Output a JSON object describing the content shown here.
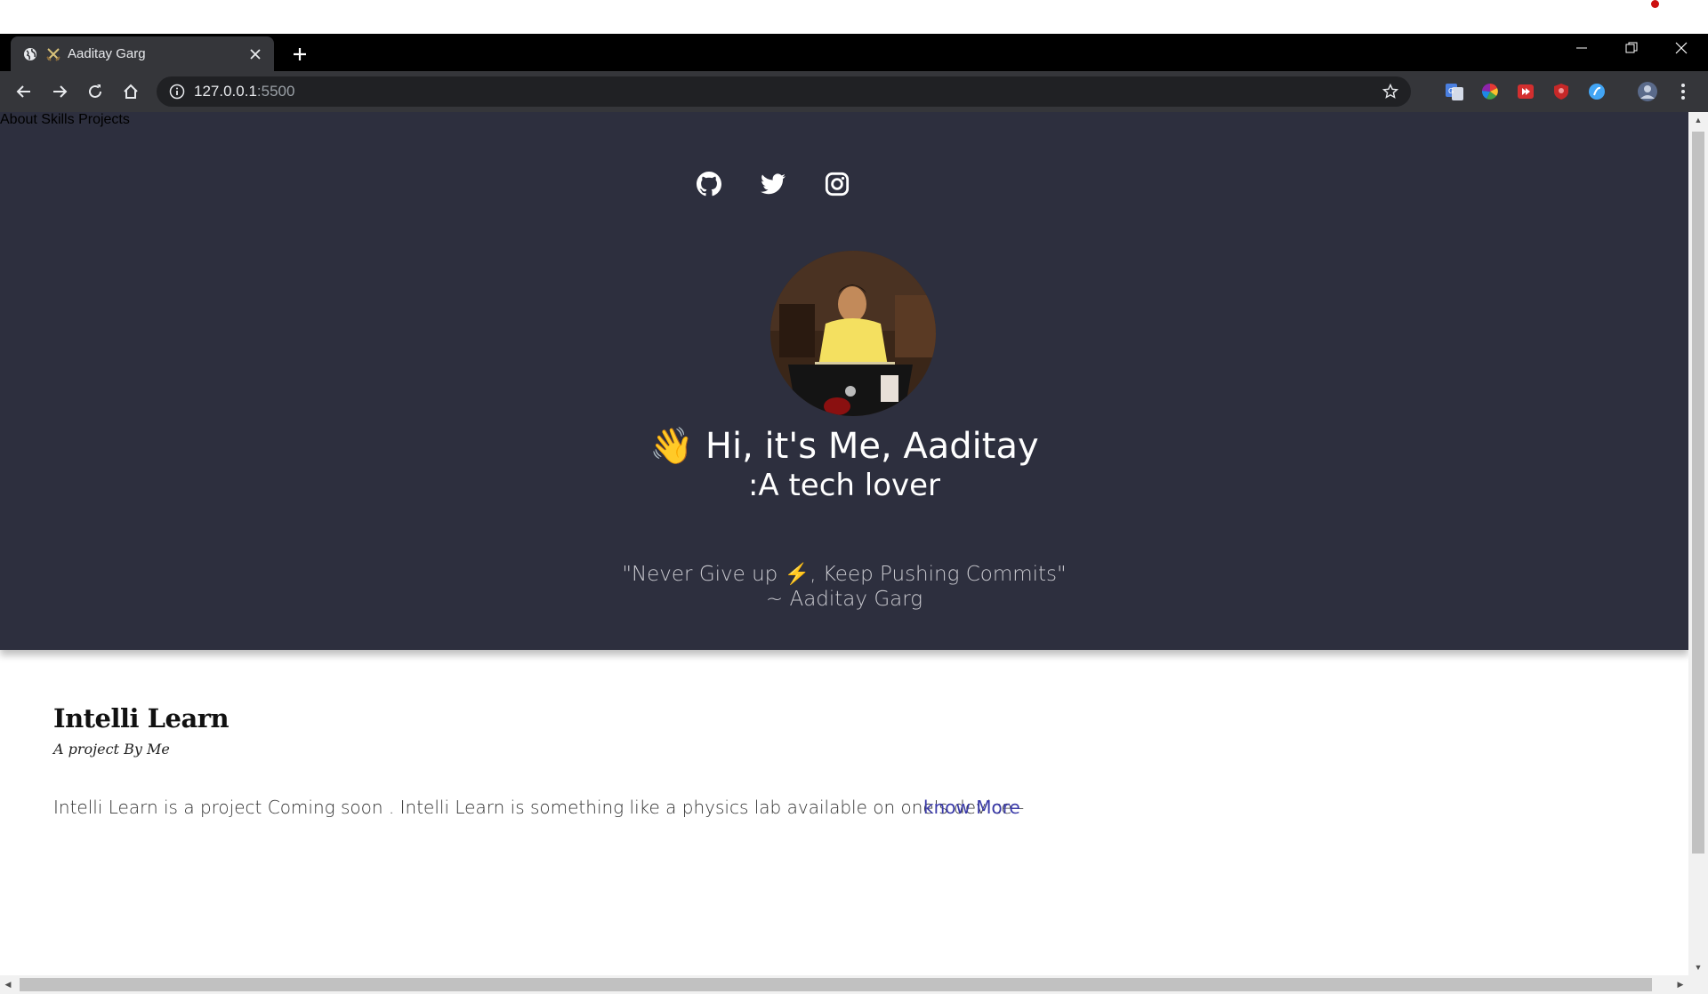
{
  "browser": {
    "tab_title": "Aaditay Garg",
    "url_host": "127.0.0.1",
    "url_port": ":5500",
    "icons": [
      "globe-icon",
      "crossed-swords-icon",
      "close-icon",
      "plus-icon",
      "minimize-icon",
      "restore-icon",
      "window-close-icon",
      "back-arrow-icon",
      "forward-arrow-icon",
      "reload-icon",
      "home-icon",
      "info-icon",
      "star-icon",
      "translate-extension-icon",
      "color-wheel-extension-icon",
      "red-play-extension-icon",
      "shield-extension-icon",
      "blue-circle-extension-icon",
      "profile-avatar-icon",
      "menu-dots-icon"
    ]
  },
  "nav": {
    "items": [
      "About",
      "Skills",
      "Projects"
    ],
    "social": [
      "github-icon",
      "twitter-icon",
      "instagram-icon"
    ]
  },
  "hero": {
    "greeting_emoji": "👋",
    "greeting": "Hi, it's Me, Aaditay",
    "tagline": ":A tech lover",
    "quote_start": "\"Never Give up",
    "quote_emoji": "⚡",
    "quote_end": ", Keep Pushing Commits\"",
    "quote_author": "~ Aaditay Garg"
  },
  "project": {
    "title": "Intelli Learn",
    "subtitle": "A project By Me",
    "description": "Intelli Learn is a project Coming soon . Intelli Learn is something like a physics lab available on one's device -",
    "link": "know More"
  },
  "colors": {
    "hero_bg": "#2d2f3e",
    "link": "#3a3aa8",
    "tabbar_bg": "#000000",
    "toolbar_bg": "#35363a"
  }
}
